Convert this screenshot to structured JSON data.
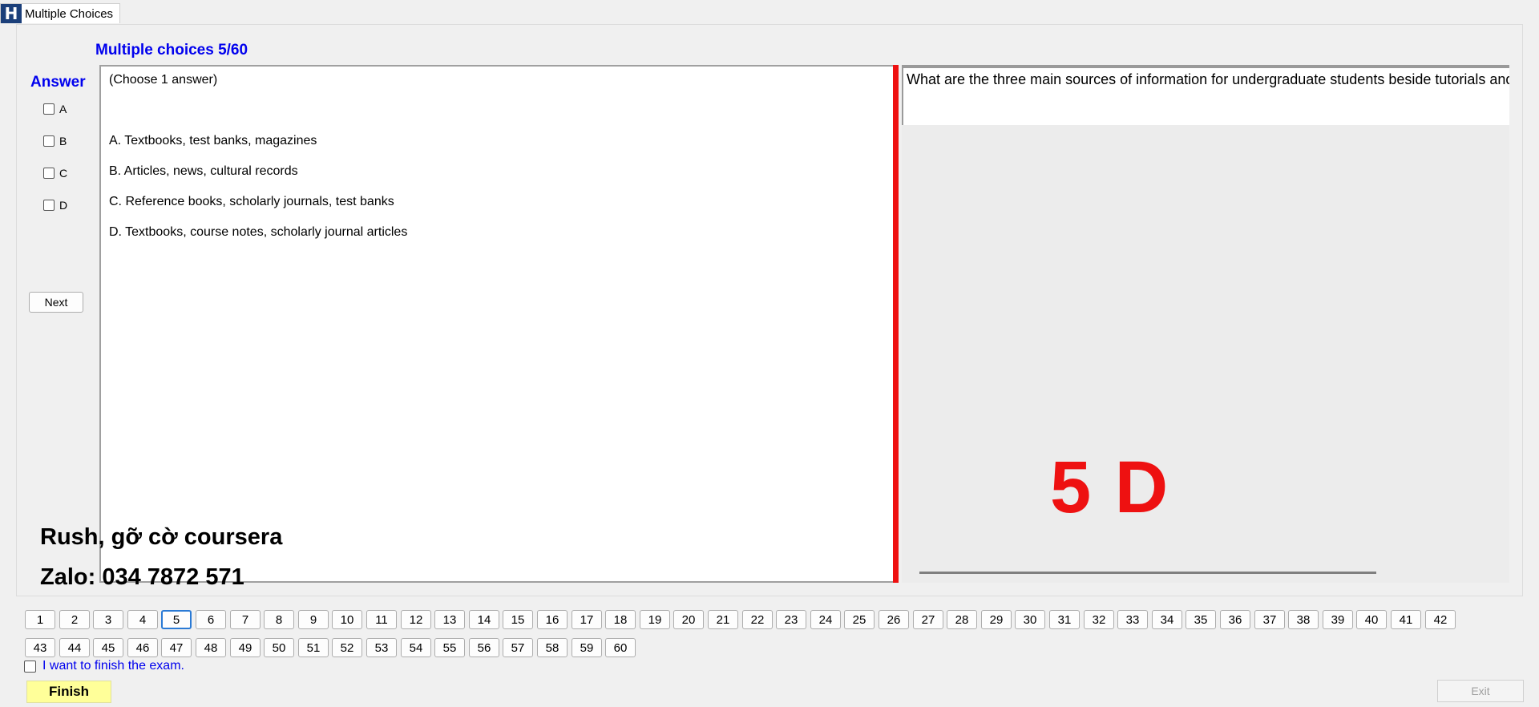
{
  "window": {
    "tab_title": "Multiple Choices",
    "icon_letter": "H"
  },
  "heading": "Multiple choices 5/60",
  "answer_panel": {
    "label": "Answer",
    "options": [
      "A",
      "B",
      "C",
      "D"
    ],
    "next_label": "Next"
  },
  "choices": {
    "note": "(Choose 1 answer)",
    "items": [
      "A.  Textbooks, test banks, magazines",
      "B.  Articles, news, cultural records",
      "C.  Reference books, scholarly journals, test banks",
      "D.  Textbooks, course notes, scholarly journal articles"
    ]
  },
  "question": {
    "text": "What are the three main sources of information for undergraduate students beside tutorials and lectures?"
  },
  "overlay": {
    "answer_marker": "5 D",
    "line1": "Rush, gỡ cờ coursera",
    "line2": "Zalo: 034 7872 571"
  },
  "navigation": {
    "current": "5",
    "row1": [
      "1",
      "2",
      "3",
      "4",
      "5",
      "6",
      "7",
      "8",
      "9",
      "10",
      "11",
      "12",
      "13",
      "14",
      "15",
      "16",
      "17",
      "18",
      "19",
      "20",
      "21",
      "22",
      "23",
      "24",
      "25",
      "26",
      "27",
      "28",
      "29",
      "30",
      "31",
      "32",
      "33",
      "34",
      "35",
      "36",
      "37",
      "38",
      "39",
      "40",
      "41",
      "42"
    ],
    "row2": [
      "43",
      "44",
      "45",
      "46",
      "47",
      "48",
      "49",
      "50",
      "51",
      "52",
      "53",
      "54",
      "55",
      "56",
      "57",
      "58",
      "59",
      "60"
    ]
  },
  "footer": {
    "finish_check_label": "I want to finish the exam.",
    "finish_label": "Finish",
    "exit_label": "Exit"
  },
  "colors": {
    "accent_blue": "#0000ee",
    "marker_red": "#ee1111",
    "finish_yellow": "#ffff99"
  }
}
